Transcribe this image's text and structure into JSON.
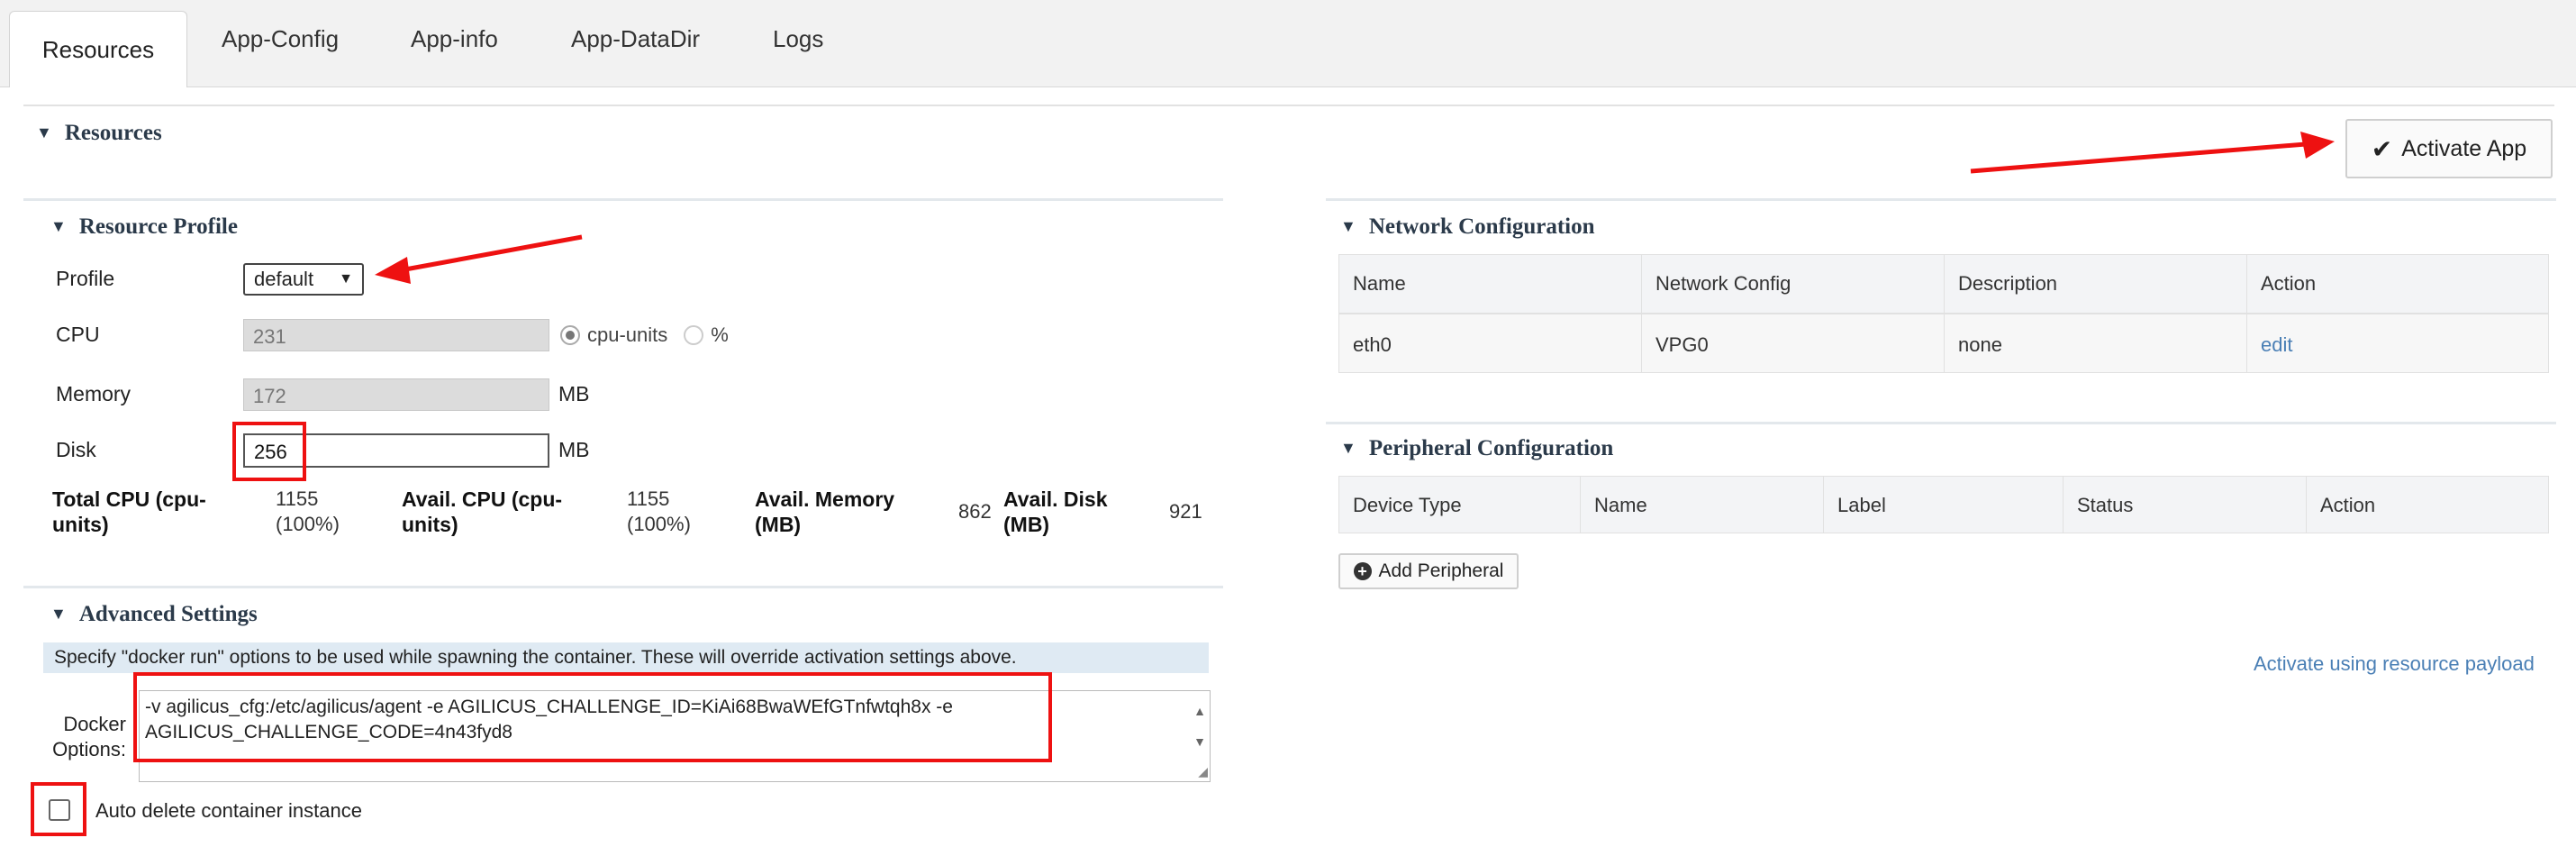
{
  "tabs": [
    "Resources",
    "App-Config",
    "App-info",
    "App-DataDir",
    "Logs"
  ],
  "resources_section": {
    "title": "Resources",
    "activate_label": "Activate App"
  },
  "resource_profile": {
    "title": "Resource Profile",
    "profile_label": "Profile",
    "profile_value": "default",
    "cpu_label": "CPU",
    "cpu_value": "231",
    "cpu_unit_option1": "cpu-units",
    "cpu_unit_option2": "%",
    "memory_label": "Memory",
    "memory_value": "172",
    "memory_unit": "MB",
    "disk_label": "Disk",
    "disk_value": "256",
    "disk_unit": "MB",
    "totals": {
      "total_cpu_label": "Total CPU (cpu-units)",
      "total_cpu_value": "1155 (100%)",
      "avail_cpu_label": "Avail. CPU (cpu-units)",
      "avail_cpu_value": "1155 (100%)",
      "avail_memory_label": "Avail. Memory (MB)",
      "avail_memory_value": "862",
      "avail_disk_label": "Avail. Disk (MB)",
      "avail_disk_value": "921"
    }
  },
  "advanced_settings": {
    "title": "Advanced Settings",
    "note": "Specify \"docker run\" options to be used while spawning the container. These will override activation settings above.",
    "docker_label": "Docker Options:",
    "docker_value": "-v agilicus_cfg:/etc/agilicus/agent -e AGILICUS_CHALLENGE_ID=KiAi68BwaWEfGTnfwtqh8x -e AGILICUS_CHALLENGE_CODE=4n43fyd8",
    "auto_delete_label": "Auto delete container instance"
  },
  "network_config": {
    "title": "Network Configuration",
    "headers": [
      "Name",
      "Network Config",
      "Description",
      "Action"
    ],
    "rows": [
      {
        "name": "eth0",
        "network_config": "VPG0",
        "description": "none",
        "action": "edit"
      }
    ]
  },
  "peripheral_config": {
    "title": "Peripheral Configuration",
    "headers": [
      "Device Type",
      "Name",
      "Label",
      "Status",
      "Action"
    ],
    "add_label": "Add Peripheral"
  },
  "activate_payload_link": "Activate using resource payload"
}
